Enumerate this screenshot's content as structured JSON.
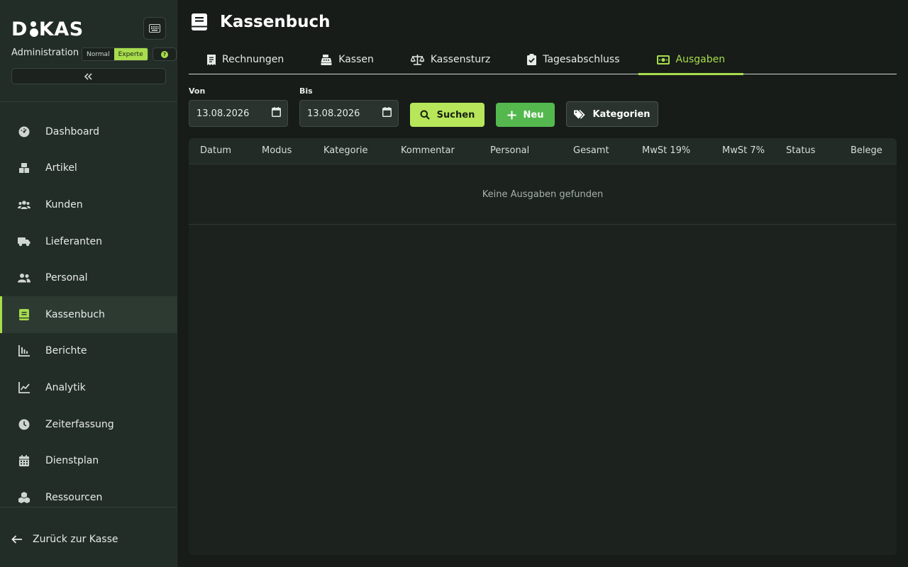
{
  "sidebar": {
    "logo": "DIKAS",
    "admin_label": "Administration",
    "mode_normal": "Normal",
    "mode_expert": "Experte",
    "items": [
      {
        "label": "Dashboard",
        "icon": "dashboard-icon"
      },
      {
        "label": "Artikel",
        "icon": "boxes-icon"
      },
      {
        "label": "Kunden",
        "icon": "users-icon"
      },
      {
        "label": "Lieferanten",
        "icon": "truck-icon"
      },
      {
        "label": "Personal",
        "icon": "user-group-icon"
      },
      {
        "label": "Kassenbuch",
        "icon": "book-icon"
      },
      {
        "label": "Berichte",
        "icon": "bar-chart-icon"
      },
      {
        "label": "Analytik",
        "icon": "line-chart-icon"
      },
      {
        "label": "Zeiterfassung",
        "icon": "clock-icon"
      },
      {
        "label": "Dienstplan",
        "icon": "calendar-icon"
      },
      {
        "label": "Ressourcen",
        "icon": "cubes-icon"
      }
    ],
    "active_item": "Kassenbuch",
    "back_label": "Zurück zur Kasse"
  },
  "header": {
    "title": "Kassenbuch"
  },
  "tabs": [
    {
      "label": "Rechnungen",
      "icon": "receipt-icon"
    },
    {
      "label": "Kassen",
      "icon": "cash-register-icon"
    },
    {
      "label": "Kassensturz",
      "icon": "scale-icon"
    },
    {
      "label": "Tagesabschluss",
      "icon": "clipboard-check-icon"
    },
    {
      "label": "Ausgaben",
      "icon": "money-bill-icon"
    }
  ],
  "active_tab": "Ausgaben",
  "filters": {
    "from_label": "Von",
    "from_value": "13.08.2026",
    "to_label": "Bis",
    "to_value": "13.08.2026",
    "search_label": "Suchen",
    "new_label": "Neu",
    "categories_label": "Kategorien"
  },
  "table": {
    "columns": [
      "Datum",
      "Modus",
      "Kategorie",
      "Kommentar",
      "Personal",
      "Gesamt",
      "MwSt 19%",
      "MwSt 7%",
      "Status",
      "Belege"
    ],
    "empty_message": "Keine Ausgaben gefunden"
  },
  "colors": {
    "accent": "#a8dd4c",
    "new_button": "#55b84f",
    "sidebar_bg": "#232d27",
    "main_bg": "#171c19"
  }
}
